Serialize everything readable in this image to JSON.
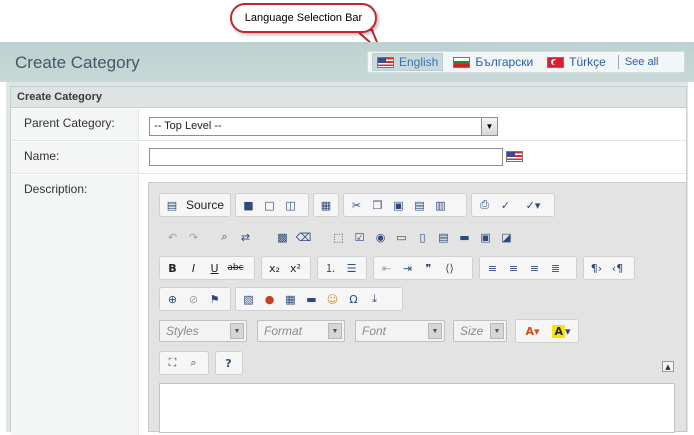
{
  "annotation": {
    "callout_text": "Language Selection Bar"
  },
  "page": {
    "title": "Create Category"
  },
  "languages": {
    "items": [
      {
        "label": "English",
        "flag": "us-flag-icon",
        "active": true
      },
      {
        "label": "Български",
        "flag": "bulgaria-flag-icon",
        "active": false
      },
      {
        "label": "Türkçe",
        "flag": "turkey-flag-icon",
        "active": false
      }
    ],
    "see_all": "See all"
  },
  "form": {
    "panel_title": "Create Category",
    "parent_label": "Parent Category:",
    "parent_value": "-- Top Level --",
    "name_label": "Name:",
    "name_value": "",
    "description_label": "Description:"
  },
  "editor": {
    "source_label": "Source",
    "styles_placeholder": "Styles",
    "format_placeholder": "Format",
    "font_placeholder": "Font",
    "size_placeholder": "Size",
    "content": ""
  },
  "colors": {
    "accent": "#c0282d",
    "header_band": "#c8d9d7",
    "link": "#2b5ba9"
  }
}
